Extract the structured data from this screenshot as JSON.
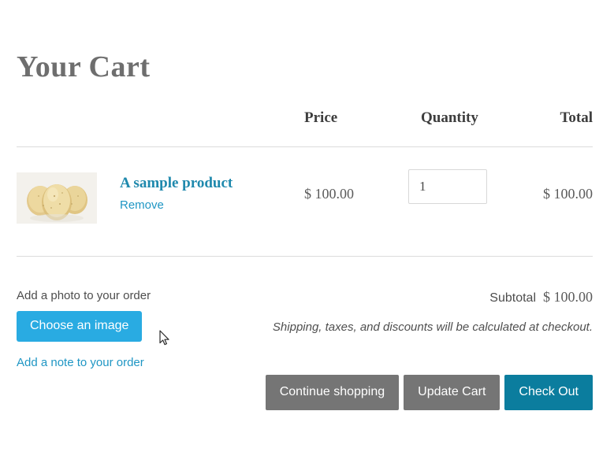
{
  "page": {
    "title": "Your Cart"
  },
  "table": {
    "headers": {
      "price": "Price",
      "quantity": "Quantity",
      "total": "Total"
    },
    "rows": [
      {
        "product_name": "A sample product",
        "remove_label": "Remove",
        "price": "$ 100.00",
        "quantity": "1",
        "total": "$ 100.00",
        "image_alt": "potatoes-photo"
      }
    ]
  },
  "footer": {
    "photo_label": "Add a photo to your order",
    "choose_image_label": "Choose an image",
    "note_link_label": "Add a note to your order",
    "subtotal_label": "Subtotal",
    "subtotal_value": "$ 100.00",
    "shipping_note": "Shipping, taxes, and discounts will be calculated at checkout.",
    "buttons": {
      "continue": "Continue shopping",
      "update": "Update Cart",
      "checkout": "Check Out"
    }
  },
  "colors": {
    "link_teal": "#1f96c4",
    "product_link": "#1f89ad",
    "choose_image_blue": "#29abe2",
    "checkout_teal": "#0b7d9e",
    "button_grey": "#757575",
    "title_grey": "#6e6e6e",
    "divider": "#dcdcdc"
  }
}
